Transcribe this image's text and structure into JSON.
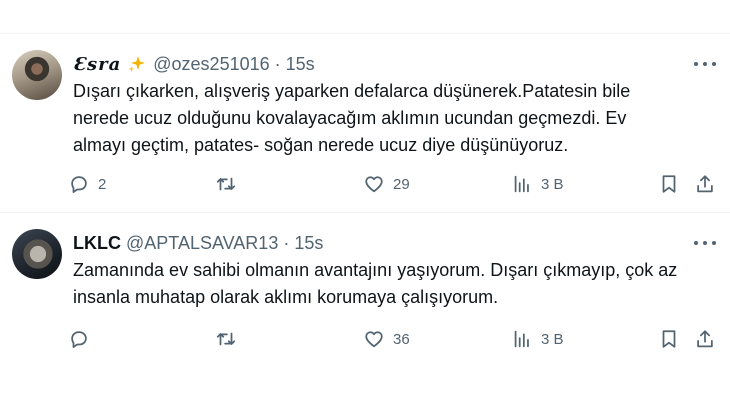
{
  "tweets": [
    {
      "display_name": "Ɛsra",
      "handle": "@ozes251016",
      "separator": "·",
      "time": "15s",
      "text": "Dışarı çıkarken, alışveriş yaparken defalarca düşünerek.Patatesin bile\nnerede ucuz olduğunu kovalayacağım  aklımın ucundan geçmezdi. Ev\nalmayı geçtim, patates- soğan nerede ucuz diye düşünüyoruz.",
      "replies": "2",
      "reposts": "",
      "likes": "29",
      "views": "3 B"
    },
    {
      "display_name": "LKLC",
      "handle": "@APTALSAVAR13",
      "separator": "·",
      "time": "15s",
      "text": "Zamanında ev sahibi olmanın avantajını yaşıyorum. Dışarı çıkmayıp, çok az\ninsanla muhatap olarak aklımı korumaya çalışıyorum.",
      "replies": "",
      "reposts": "",
      "likes": "36",
      "views": "3 B"
    }
  ]
}
